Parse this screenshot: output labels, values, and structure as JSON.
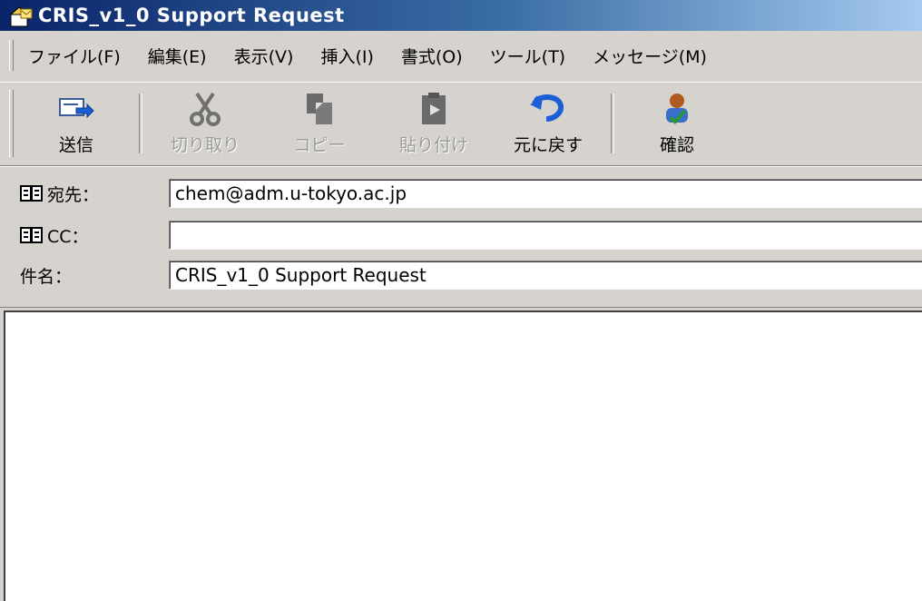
{
  "window": {
    "title": "CRIS_v1_0 Support Request",
    "icon": "compose-mail-icon"
  },
  "menu": [
    {
      "label": "ファイル(F)"
    },
    {
      "label": "編集(E)"
    },
    {
      "label": "表示(V)"
    },
    {
      "label": "挿入(I)"
    },
    {
      "label": "書式(O)"
    },
    {
      "label": "ツール(T)"
    },
    {
      "label": "メッセージ(M)"
    }
  ],
  "toolbar": {
    "send": {
      "label": "送信",
      "icon": "send-icon",
      "enabled": true
    },
    "cut": {
      "label": "切り取り",
      "icon": "scissors-icon",
      "enabled": false
    },
    "copy": {
      "label": "コピー",
      "icon": "copy-icon",
      "enabled": false
    },
    "paste": {
      "label": "貼り付け",
      "icon": "paste-icon",
      "enabled": false
    },
    "undo": {
      "label": "元に戻す",
      "icon": "undo-icon",
      "enabled": true
    },
    "check": {
      "label": "確認",
      "icon": "check-names-icon",
      "enabled": true
    }
  },
  "fields": {
    "to": {
      "label": "宛先：",
      "value": "chem@adm.u-tokyo.ac.jp"
    },
    "cc": {
      "label": "CC：",
      "value": ""
    },
    "subject": {
      "label": "件名：",
      "value": "CRIS_v1_0 Support Request"
    }
  },
  "body": {
    "text": ""
  },
  "colors": {
    "titlebar_start": "#0a246a",
    "titlebar_end": "#a6caf0",
    "chrome": "#d6d3ce",
    "undo_accent": "#1a5fd6",
    "send_accent": "#1a5fd6"
  }
}
